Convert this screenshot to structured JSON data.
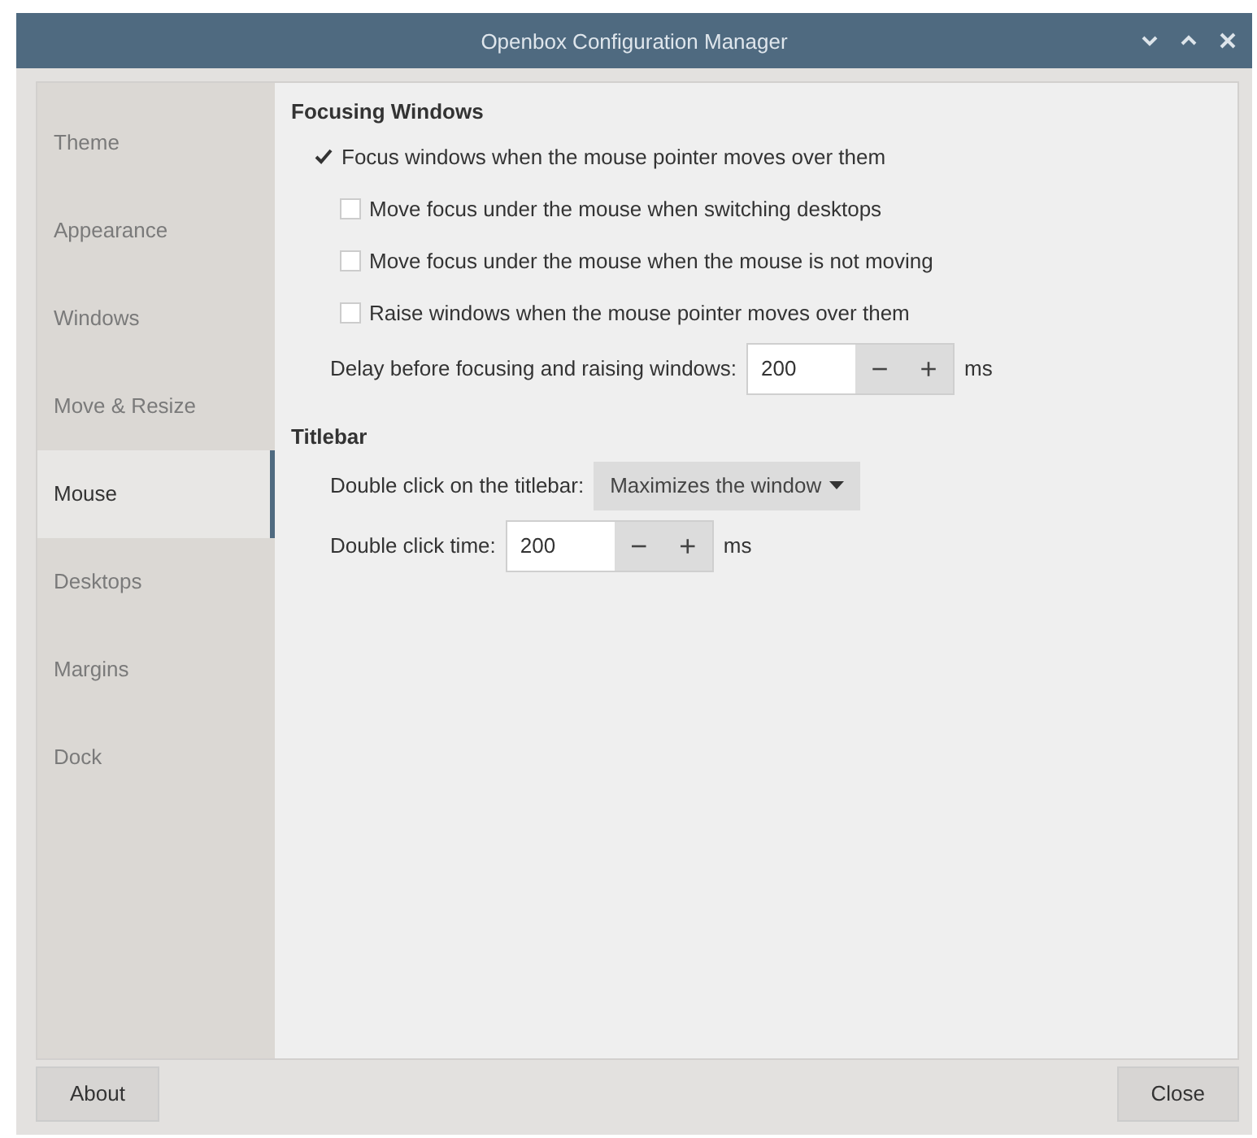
{
  "window": {
    "title": "Openbox Configuration Manager"
  },
  "sidebar": {
    "items": [
      {
        "label": "Theme",
        "selected": false
      },
      {
        "label": "Appearance",
        "selected": false
      },
      {
        "label": "Windows",
        "selected": false
      },
      {
        "label": "Move & Resize",
        "selected": false
      },
      {
        "label": "Mouse",
        "selected": true
      },
      {
        "label": "Desktops",
        "selected": false
      },
      {
        "label": "Margins",
        "selected": false
      },
      {
        "label": "Dock",
        "selected": false
      }
    ]
  },
  "sections": [
    {
      "title": "Focusing Windows",
      "rows": [
        {
          "kind": "checkbox",
          "label": "Focus windows when the mouse pointer moves over them",
          "checked": true,
          "children": [
            {
              "kind": "checkbox",
              "label": "Move focus under the mouse when switching desktops",
              "checked": false
            },
            {
              "kind": "checkbox",
              "label": "Move focus under the mouse when the mouse is not moving",
              "checked": false
            },
            {
              "kind": "checkbox",
              "label": "Raise windows when the mouse pointer moves over them",
              "checked": false
            }
          ]
        },
        {
          "kind": "spin",
          "label": "Delay before focusing and raising windows:",
          "value": "200",
          "minus": "−",
          "plus": "+",
          "unit": "ms"
        }
      ]
    },
    {
      "title": "Titlebar",
      "rows": [
        {
          "kind": "dropdown",
          "label": "Double click on the titlebar:",
          "value": "Maximizes the window"
        },
        {
          "kind": "spin",
          "label": "Double click time:",
          "value": "200",
          "minus": "−",
          "plus": "+",
          "unit": "ms"
        }
      ]
    }
  ],
  "buttons": [
    {
      "label": "About"
    },
    {
      "label": "Close"
    }
  ]
}
